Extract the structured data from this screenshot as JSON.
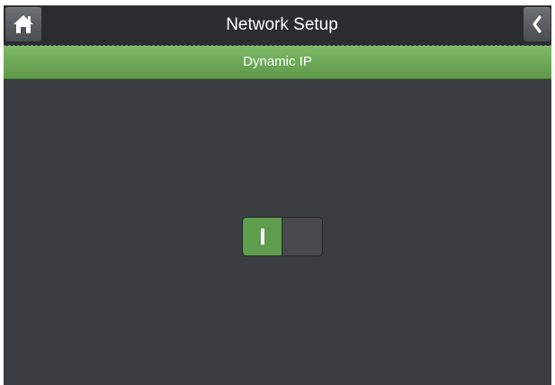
{
  "header": {
    "title": "Network Setup",
    "home_icon": "home-icon",
    "back_icon": "chevron-left-icon"
  },
  "section": {
    "title": "Dynamic IP"
  },
  "toggle": {
    "state": "on",
    "on_color": "#5f9c4c",
    "off_color": "#47494d"
  },
  "colors": {
    "background": "#3a3d41",
    "header": "#2a2c2f",
    "accent": "#6aa856"
  }
}
